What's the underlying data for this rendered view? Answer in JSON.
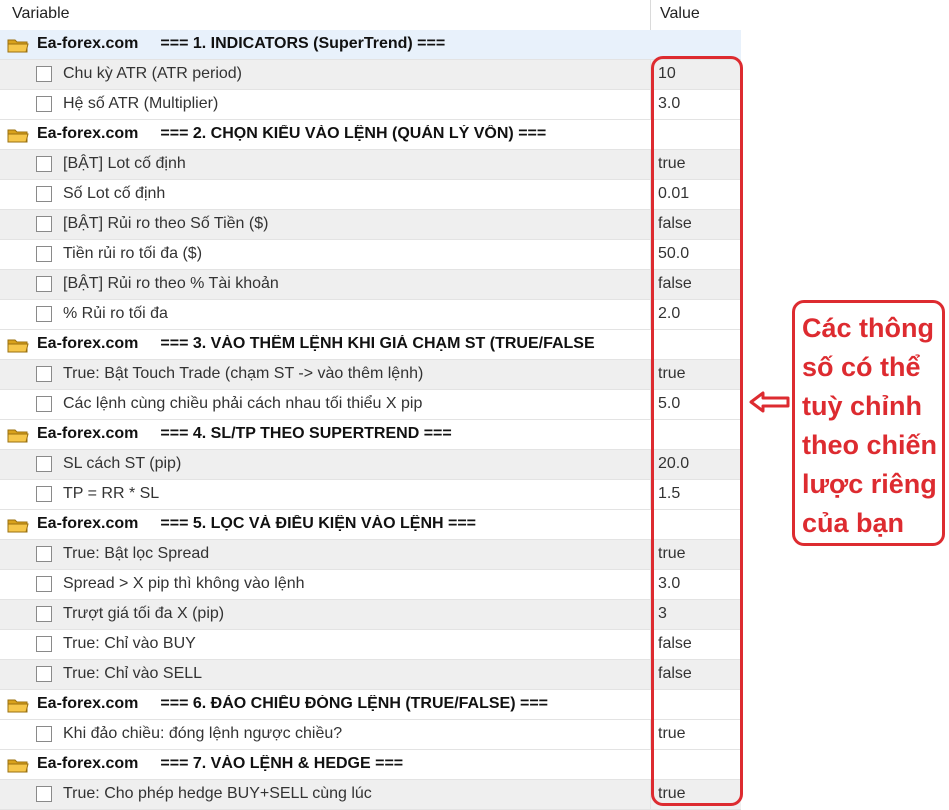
{
  "columns": {
    "variable": "Variable",
    "value": "Value"
  },
  "rows": [
    {
      "kind": "group",
      "site": "Ea-forex.com",
      "title": "=== 1. INDICATORS (SuperTrend) ==="
    },
    {
      "kind": "param",
      "name": "Chu kỳ ATR (ATR period)",
      "value": "10"
    },
    {
      "kind": "param",
      "name": "Hệ số ATR (Multiplier)",
      "value": "3.0"
    },
    {
      "kind": "group",
      "site": "Ea-forex.com",
      "title": "=== 2. CHỌN KIỂU VÀO LỆNH (QUẢN LÝ VỐN) ==="
    },
    {
      "kind": "param",
      "name": "[BẬT] Lot cố định",
      "value": "true"
    },
    {
      "kind": "param",
      "name": "Số Lot cố định",
      "value": "0.01"
    },
    {
      "kind": "param",
      "name": "[BẬT] Rủi ro theo Số Tiền ($)",
      "value": "false"
    },
    {
      "kind": "param",
      "name": "Tiền rủi ro tối đa ($)",
      "value": "50.0"
    },
    {
      "kind": "param",
      "name": "[BẬT] Rủi ro theo % Tài khoản",
      "value": "false"
    },
    {
      "kind": "param",
      "name": "% Rủi ro tối đa",
      "value": "2.0"
    },
    {
      "kind": "group",
      "site": "Ea-forex.com",
      "title": "=== 3. VÀO THÊM LỆNH KHI GIÁ CHẠM ST (TRUE/FALSE"
    },
    {
      "kind": "param",
      "name": "True: Bật Touch Trade (chạm ST -> vào thêm lệnh)",
      "value": "true"
    },
    {
      "kind": "param",
      "name": "Các lệnh cùng chiều phải cách nhau tối thiểu X pip",
      "value": "5.0"
    },
    {
      "kind": "group",
      "site": "Ea-forex.com",
      "title": "=== 4. SL/TP THEO SUPERTREND ==="
    },
    {
      "kind": "param",
      "name": "SL cách ST (pip)",
      "value": "20.0"
    },
    {
      "kind": "param",
      "name": "TP = RR * SL",
      "value": "1.5"
    },
    {
      "kind": "group",
      "site": "Ea-forex.com",
      "title": "=== 5. LỌC VÀ ĐIỀU KIỆN VÀO LỆNH ==="
    },
    {
      "kind": "param",
      "name": "True: Bật lọc Spread",
      "value": "true"
    },
    {
      "kind": "param",
      "name": "Spread > X pip thì không vào lệnh",
      "value": "3.0"
    },
    {
      "kind": "param",
      "name": "Trượt giá tối đa X (pip)",
      "value": "3"
    },
    {
      "kind": "param",
      "name": "True: Chỉ vào BUY",
      "value": "false"
    },
    {
      "kind": "param",
      "name": "True: Chỉ vào SELL",
      "value": "false"
    },
    {
      "kind": "group",
      "site": "Ea-forex.com",
      "title": "=== 6. ĐẢO CHIỀU ĐÓNG LỆNH (TRUE/FALSE) ==="
    },
    {
      "kind": "param",
      "name": "Khi đảo chiều: đóng lệnh ngược chiều?",
      "value": "true"
    },
    {
      "kind": "group",
      "site": "Ea-forex.com",
      "title": "=== 7. VÀO LỆNH & HEDGE ==="
    },
    {
      "kind": "param",
      "name": "True: Cho phép hedge BUY+SELL cùng lúc",
      "value": "true"
    }
  ],
  "annotation": {
    "lines": [
      "Các thông",
      "số có thể",
      "tuỳ chỉnh",
      "theo chiến",
      "lược riêng",
      "của bạn"
    ],
    "color": "#dd2b30"
  },
  "icons": {
    "group": "folder-icon",
    "param": "checkbox",
    "pointer": "left-arrow-icon"
  }
}
